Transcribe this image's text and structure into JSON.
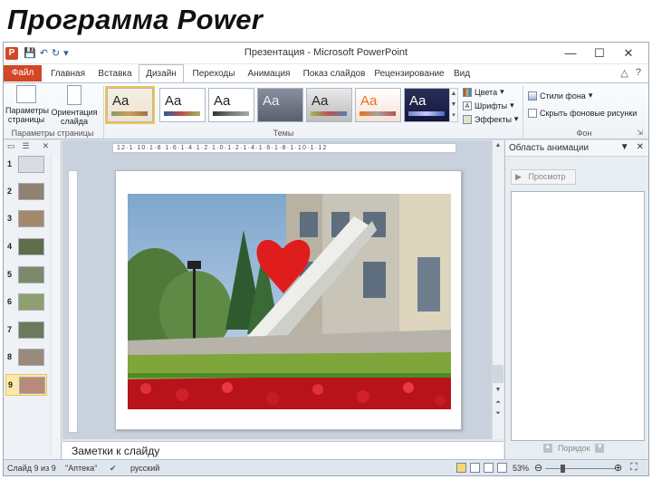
{
  "page_heading": "Программа Power",
  "window": {
    "title": "Презентация - Microsoft PowerPoint",
    "app_icon_letter": "P",
    "minimize": "—",
    "maximize": "☐",
    "close": "✕"
  },
  "tabs": {
    "file": "Файл",
    "home": "Главная",
    "insert": "Вставка",
    "design": "Дизайн",
    "transitions": "Переходы",
    "animation": "Анимация",
    "slideshow": "Показ слайдов",
    "review": "Рецензирование",
    "view": "Вид"
  },
  "ribbon": {
    "page_setup": "Параметры страницы",
    "orientation": "Ориентация слайда",
    "group_page_setup": "Параметры страницы",
    "group_themes": "Темы",
    "colors": "Цвета",
    "fonts": "Шрифты",
    "effects": "Эффекты",
    "bg_styles": "Стили фона",
    "hide_bg": "Скрыть фоновые рисунки",
    "group_background": "Фон",
    "theme_sample": "Aa"
  },
  "thumbnails": [
    "1",
    "2",
    "3",
    "4",
    "5",
    "6",
    "7",
    "8",
    "9"
  ],
  "ruler_text": "12·1·10·1·8·1·6·1·4·1·2·1·0·1·2·1·4·1·6·1·8·1·10·1·12",
  "notes_placeholder": "Заметки к слайду",
  "anim_panel": {
    "title": "Область анимации",
    "preview": "Просмотр",
    "order": "Порядок"
  },
  "statusbar": {
    "slide_info": "Слайд 9 из 9",
    "theme": "\"Аптека\"",
    "language": "русский",
    "zoom": "53%"
  },
  "colors": {
    "file_tab": "#d24726",
    "selected_thumb": "#fbe9a9",
    "accent": "#2e5c99"
  }
}
